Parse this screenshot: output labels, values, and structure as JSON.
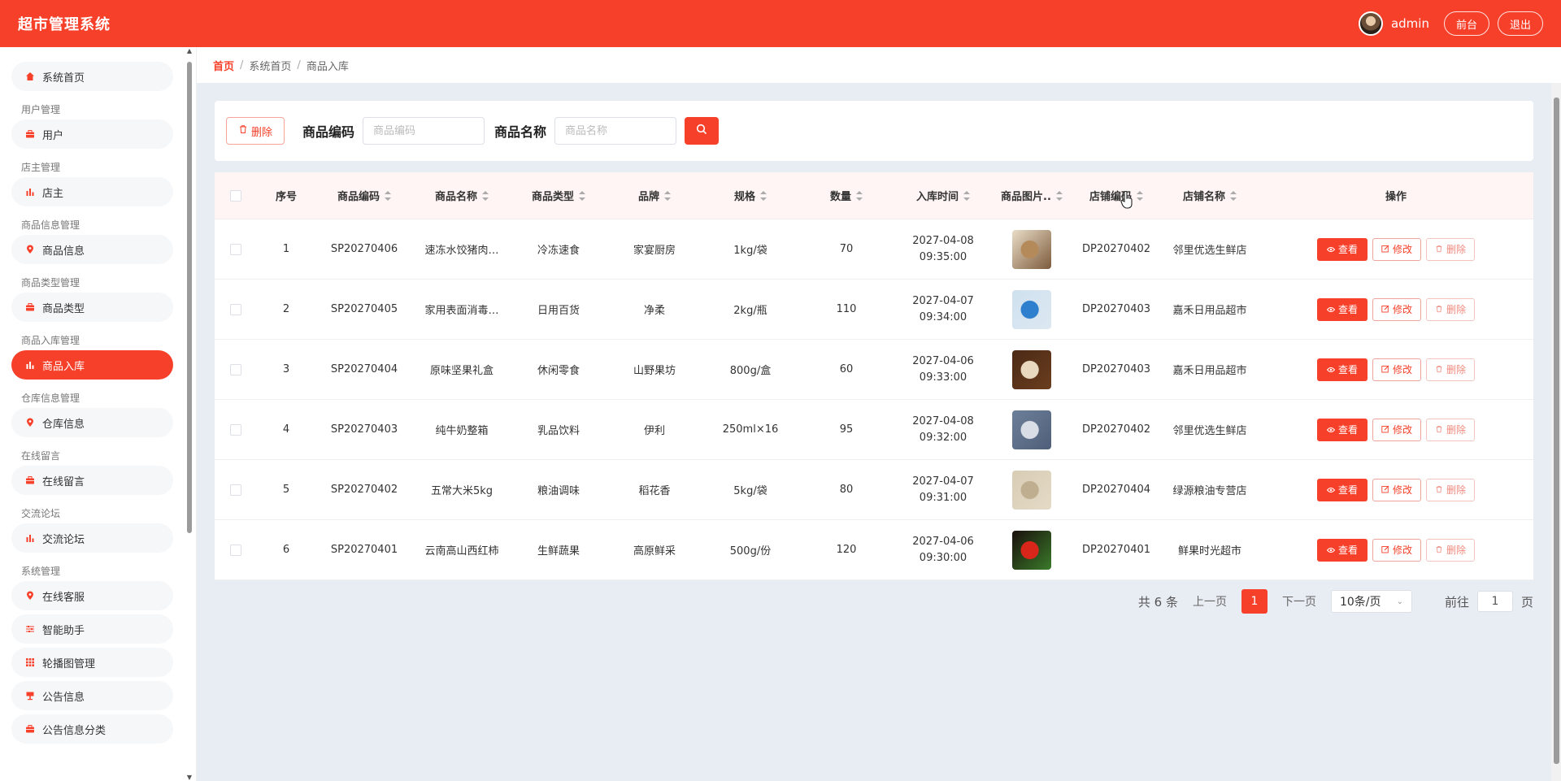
{
  "header": {
    "title": "超市管理系统",
    "username": "admin",
    "front_label": "前台",
    "logout_label": "退出"
  },
  "sidebar": {
    "top_item": {
      "label": "系统首页",
      "icon": "home-icon"
    },
    "groups": [
      {
        "title": "用户管理",
        "items": [
          {
            "label": "用户",
            "icon": "briefcase-icon"
          }
        ]
      },
      {
        "title": "店主管理",
        "items": [
          {
            "label": "店主",
            "icon": "bar-chart-icon"
          }
        ]
      },
      {
        "title": "商品信息管理",
        "items": [
          {
            "label": "商品信息",
            "icon": "location-pin-icon"
          }
        ]
      },
      {
        "title": "商品类型管理",
        "items": [
          {
            "label": "商品类型",
            "icon": "briefcase-icon"
          }
        ]
      },
      {
        "title": "商品入库管理",
        "items": [
          {
            "label": "商品入库",
            "icon": "bar-chart-icon",
            "active": true
          }
        ]
      },
      {
        "title": "仓库信息管理",
        "items": [
          {
            "label": "仓库信息",
            "icon": "location-pin-icon"
          }
        ]
      },
      {
        "title": "在线留言",
        "items": [
          {
            "label": "在线留言",
            "icon": "briefcase-icon"
          }
        ]
      },
      {
        "title": "交流论坛",
        "items": [
          {
            "label": "交流论坛",
            "icon": "bar-chart-icon"
          }
        ]
      },
      {
        "title": "系统管理",
        "items": [
          {
            "label": "在线客服",
            "icon": "location-pin-icon"
          },
          {
            "label": "智能助手",
            "icon": "sliders-icon"
          },
          {
            "label": "轮播图管理",
            "icon": "grid-icon"
          },
          {
            "label": "公告信息",
            "icon": "sign-icon"
          },
          {
            "label": "公告信息分类",
            "icon": "briefcase-icon"
          }
        ]
      }
    ]
  },
  "breadcrumb": {
    "home": "首页",
    "level1": "系统首页",
    "level2": "商品入库"
  },
  "toolbar": {
    "delete_label": "删除",
    "code_label": "商品编码",
    "code_placeholder": "商品编码",
    "name_label": "商品名称",
    "name_placeholder": "商品名称"
  },
  "table": {
    "headers": {
      "index": "序号",
      "code": "商品编码",
      "name": "商品名称",
      "type": "商品类型",
      "brand": "品牌",
      "spec": "规格",
      "qty": "数量",
      "time": "入库时间",
      "image": "商品图片..",
      "shop_code": "店铺编码",
      "shop_name": "店铺名称",
      "ops": "操作"
    },
    "action_labels": {
      "view": "查看",
      "edit": "修改",
      "delete": "删除"
    },
    "rows": [
      {
        "index": "1",
        "code": "SP20270406",
        "name": "速冻水饺猪肉…",
        "type": "冷冻速食",
        "brand": "家宴厨房",
        "spec": "1kg/袋",
        "qty": "70",
        "date": "2027-04-08",
        "time": "09:35:00",
        "shop_code": "DP20270402",
        "shop_name": "邻里优选生鲜店",
        "img_colors": [
          "#e9ddc8",
          "#b58a5a",
          "#7d5b3b"
        ]
      },
      {
        "index": "2",
        "code": "SP20270405",
        "name": "家用表面消毒…",
        "type": "日用百货",
        "brand": "净柔",
        "spec": "2kg/瓶",
        "qty": "110",
        "date": "2027-04-07",
        "time": "09:34:00",
        "shop_code": "DP20270403",
        "shop_name": "嘉禾日用品超市",
        "img_colors": [
          "#cfe1ee",
          "#2f7fcf",
          "#dce8f2"
        ]
      },
      {
        "index": "3",
        "code": "SP20270404",
        "name": "原味坚果礼盒",
        "type": "休闲零食",
        "brand": "山野果坊",
        "spec": "800g/盒",
        "qty": "60",
        "date": "2027-04-06",
        "time": "09:33:00",
        "shop_code": "DP20270403",
        "shop_name": "嘉禾日用品超市",
        "img_colors": [
          "#4a2a16",
          "#e8d8c0",
          "#6b3d1e"
        ]
      },
      {
        "index": "4",
        "code": "SP20270403",
        "name": "纯牛奶整箱",
        "type": "乳品饮料",
        "brand": "伊利",
        "spec": "250ml×16",
        "qty": "95",
        "date": "2027-04-08",
        "time": "09:32:00",
        "shop_code": "DP20270402",
        "shop_name": "邻里优选生鲜店",
        "img_colors": [
          "#6d7f99",
          "#d9dde6",
          "#4f5f7a"
        ]
      },
      {
        "index": "5",
        "code": "SP20270402",
        "name": "五常大米5kg",
        "type": "粮油调味",
        "brand": "稻花香",
        "spec": "5kg/袋",
        "qty": "80",
        "date": "2027-04-07",
        "time": "09:31:00",
        "shop_code": "DP20270404",
        "shop_name": "绿源粮油专营店",
        "img_colors": [
          "#d8ccb4",
          "#bfae8f",
          "#e4dac6"
        ]
      },
      {
        "index": "6",
        "code": "SP20270401",
        "name": "云南高山西红柿",
        "type": "生鲜蔬果",
        "brand": "高原鲜采",
        "spec": "500g/份",
        "qty": "120",
        "date": "2027-04-06",
        "time": "09:30:00",
        "shop_code": "DP20270401",
        "shop_name": "鲜果时光超市",
        "img_colors": [
          "#1a0f0c",
          "#d8261a",
          "#3a7a2a"
        ]
      }
    ]
  },
  "pager": {
    "total_label": "共 6 条",
    "prev_label": "上一页",
    "current_page": "1",
    "next_label": "下一页",
    "page_size": "10条/页",
    "goto_label": "前往",
    "goto_value": "1",
    "page_unit": "页"
  }
}
